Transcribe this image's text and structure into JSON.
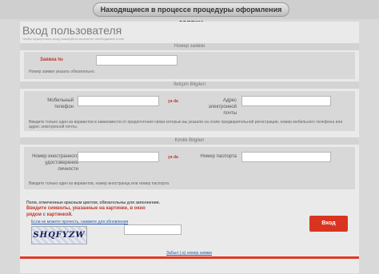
{
  "banner": {
    "title": "Находящиеся в процессе процедуры оформления заявки"
  },
  "page": {
    "title": "Вход пользователя",
    "subtitle": "Чтобы осуществить вход пожалуйста заполните необходимые поля!"
  },
  "application": {
    "header": "Номер заявки",
    "label": "Заявка №",
    "value": "",
    "hint": "Номер заявки указать обязательно."
  },
  "contact": {
    "header": "İletişim Bilgileri",
    "phone_label": "Мобильный телефон",
    "phone_value": "",
    "or_text": "ya da",
    "email_label": "Адрес электронной почты",
    "email_value": "",
    "hint": "Введите только один из вариантов в зависимости от предпочтения связи которые вы указали на этапе предварительной регистрации, номер мобильного телефона или адрес электронной почты."
  },
  "identity": {
    "header": "Kimlik Bilgileri",
    "foreign_id_label": "Номер иностранного удостоверения личности",
    "foreign_id_value": "",
    "or_text": "ya da",
    "passport_label": "Номер паспорта",
    "passport_value": "",
    "hint": "Введите только один из вариантов, номер иностранца или номер паспорта."
  },
  "captcha": {
    "required_note": "Поля, отмеченные красным цветом, обязательны для заполнения.",
    "message": "Введите символы, указанные на картинке, в окно рядом с картинкой.",
    "refresh_link": "Если не можете прочесть, нажмите для обновления",
    "code": "SHQFYZW",
    "value": ""
  },
  "actions": {
    "login_label": "Вход",
    "forgot_link": "Забыл (-а) номер заявки"
  },
  "colors": {
    "accent": "#d9341f",
    "link": "#2a5db0"
  }
}
